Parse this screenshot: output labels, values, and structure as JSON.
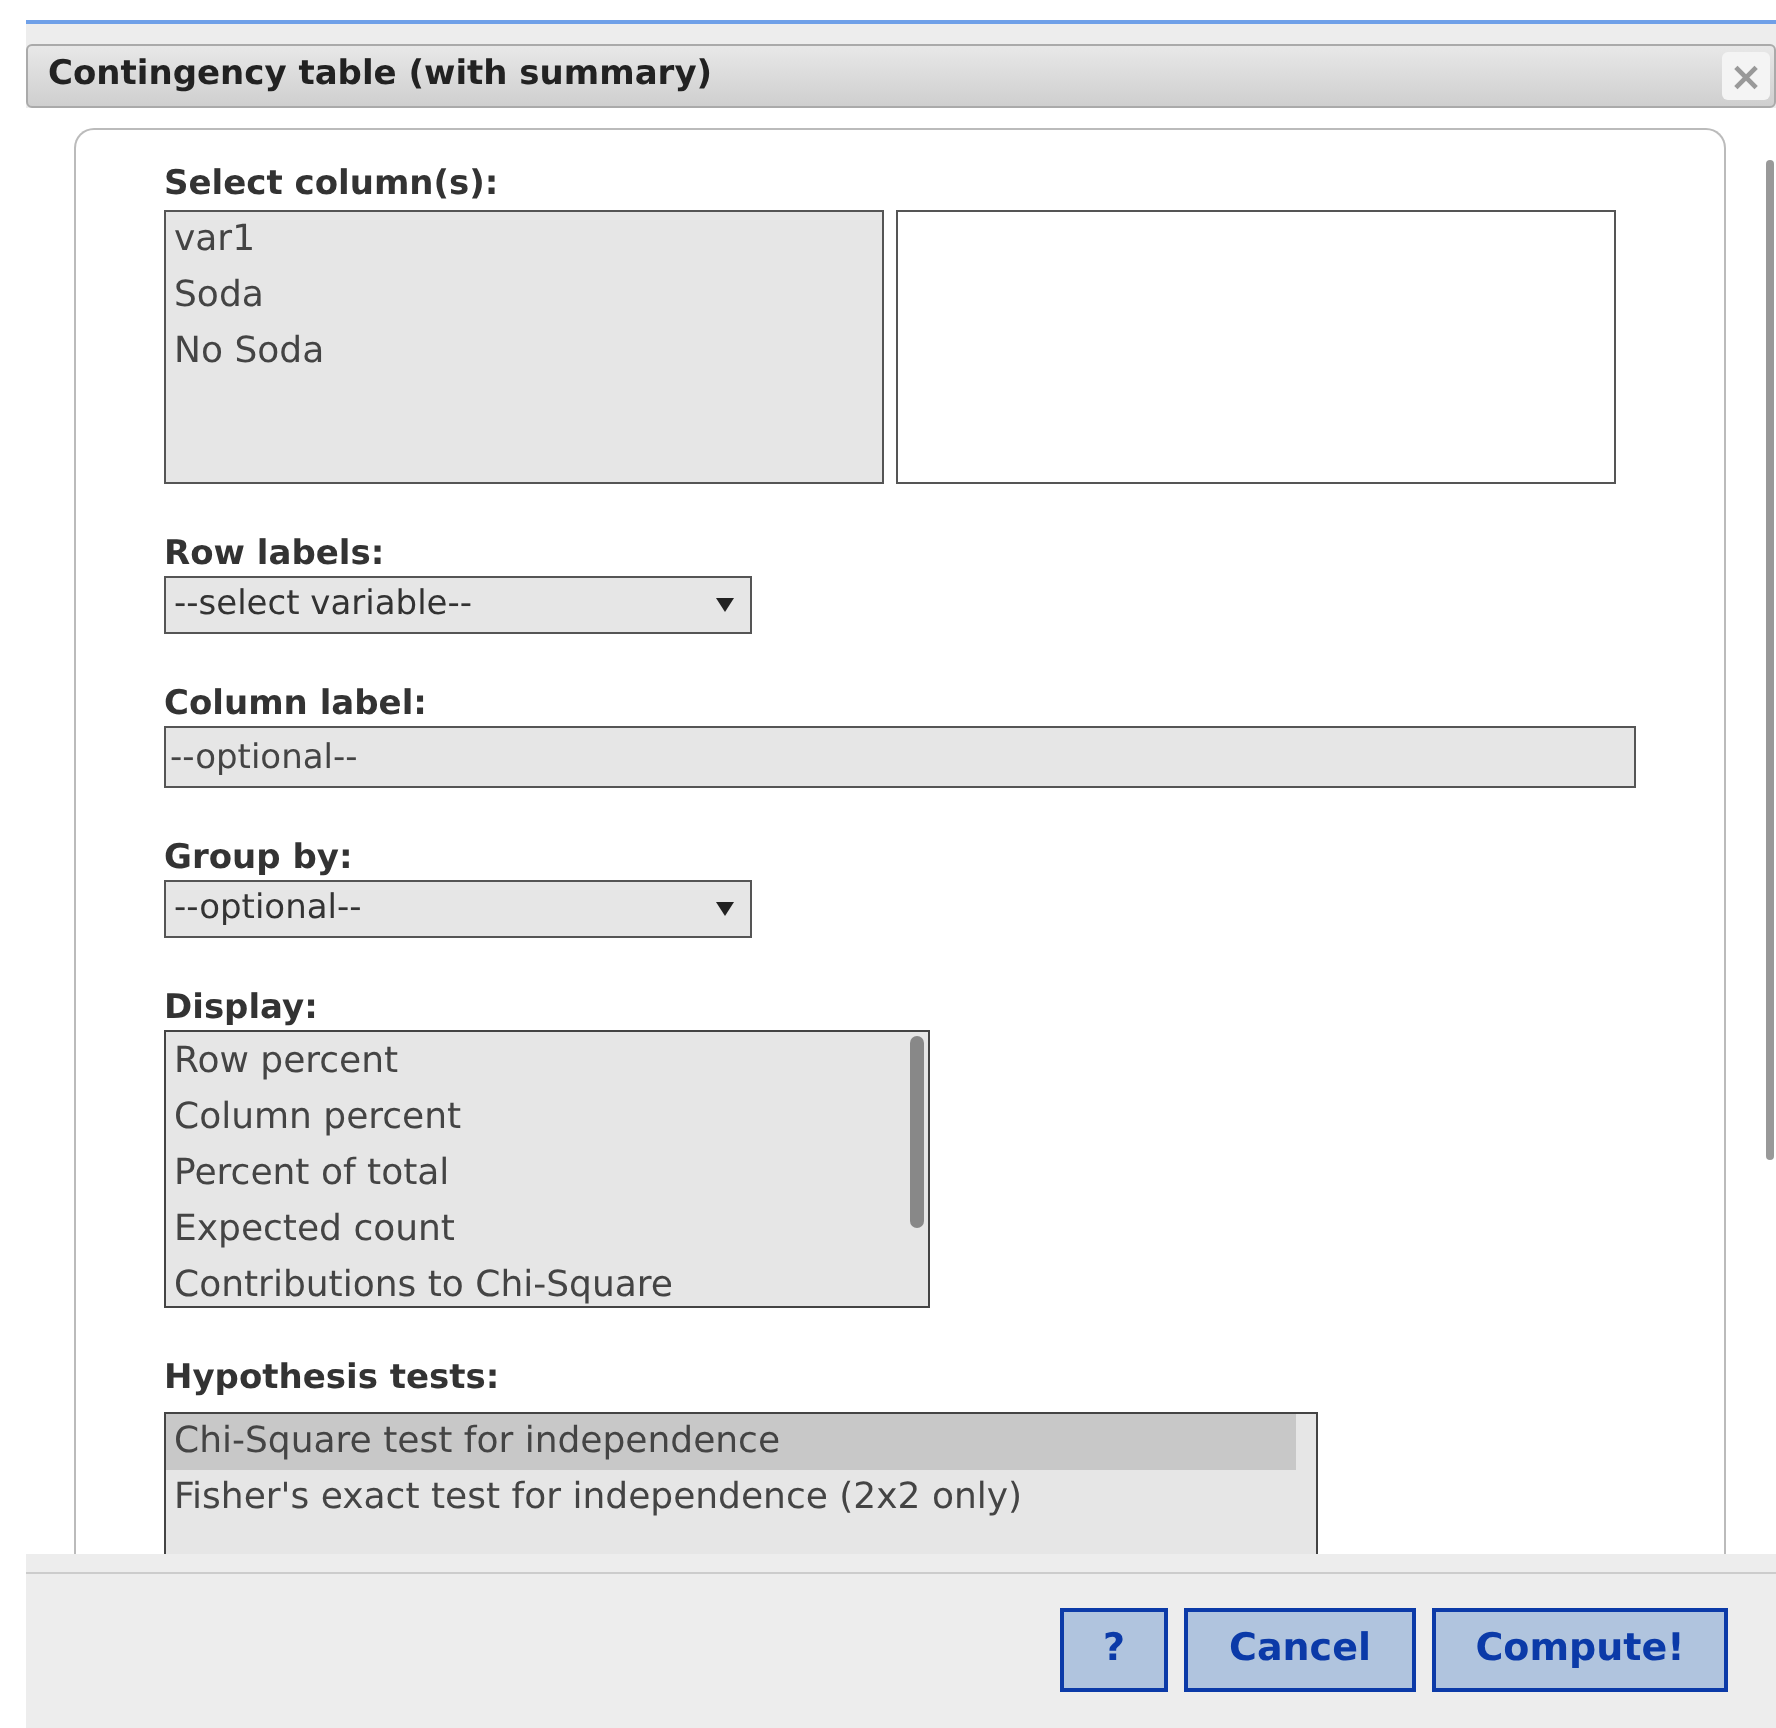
{
  "dialog": {
    "title": "Contingency table (with summary)",
    "close": "×"
  },
  "select_columns": {
    "label": "Select column(s):",
    "available": [
      {
        "label": "var1",
        "selected": false
      },
      {
        "label": "Soda",
        "selected": false
      },
      {
        "label": "No Soda",
        "selected": false
      }
    ]
  },
  "row_labels": {
    "label": "Row labels:",
    "value": "--select variable--"
  },
  "column_label": {
    "label": "Column label:",
    "placeholder": "--optional--"
  },
  "group_by": {
    "label": "Group by:",
    "value": "--optional--"
  },
  "display": {
    "label": "Display:",
    "options": [
      {
        "label": "Row percent",
        "selected": false
      },
      {
        "label": "Column percent",
        "selected": false
      },
      {
        "label": "Percent of total",
        "selected": false
      },
      {
        "label": "Expected count",
        "selected": false
      },
      {
        "label": "Contributions to Chi-Square",
        "selected": false
      }
    ]
  },
  "hypothesis_tests": {
    "label": "Hypothesis tests:",
    "options": [
      {
        "label": "Chi-Square test for independence",
        "selected": true
      },
      {
        "label": "Fisher's exact test for independence (2x2 only)",
        "selected": false
      }
    ]
  },
  "buttons": [
    "?",
    "Cancel",
    "Compute!"
  ]
}
